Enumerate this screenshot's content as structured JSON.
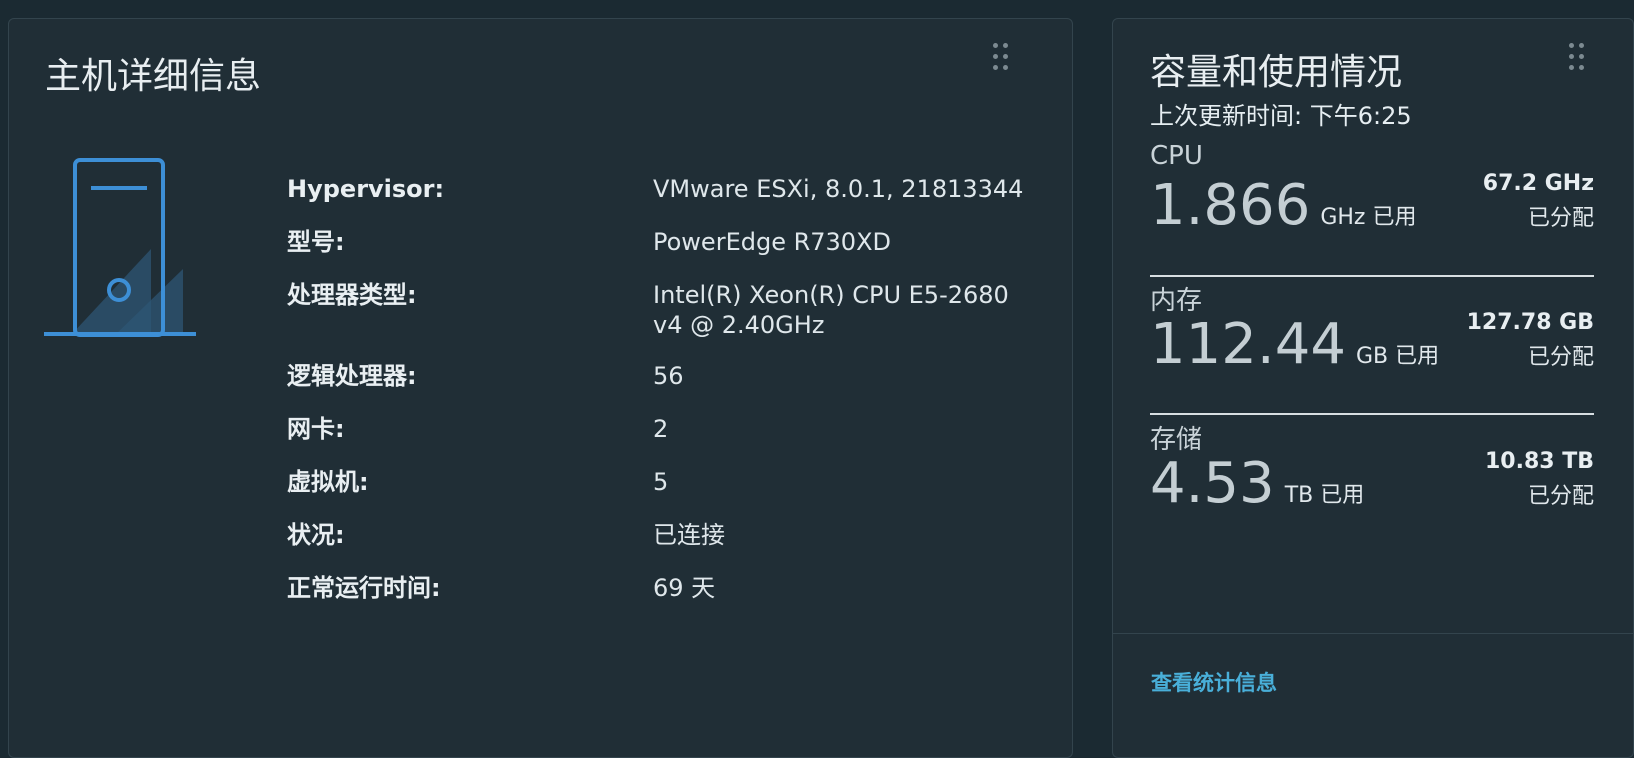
{
  "host_details": {
    "title": "主机详细信息",
    "icon": "server-icon",
    "rows": [
      {
        "label": "Hypervisor:",
        "value": "VMware ESXi, 8.0.1, 21813344"
      },
      {
        "label": "型号:",
        "value": "PowerEdge R730XD"
      },
      {
        "label": "处理器类型:",
        "value": "Intel(R) Xeon(R) CPU E5-2680 v4 @ 2.40GHz"
      },
      {
        "label": "逻辑处理器:",
        "value": "56"
      },
      {
        "label": "网卡:",
        "value": "2"
      },
      {
        "label": "虚拟机:",
        "value": "5"
      },
      {
        "label": "状况:",
        "value": "已连接"
      },
      {
        "label": "正常运行时间:",
        "value": "69 天"
      }
    ]
  },
  "capacity": {
    "title": "容量和使用情况",
    "last_updated": "上次更新时间: 下午6:25",
    "resources": [
      {
        "name": "CPU",
        "used": "1.866",
        "used_unit": "GHz 已用",
        "allocated": "67.2 GHz",
        "allocated_label": "已分配"
      },
      {
        "name": "内存",
        "used": "112.44",
        "used_unit": "GB 已用",
        "allocated": "127.78 GB",
        "allocated_label": "已分配"
      },
      {
        "name": "存储",
        "used": "4.53",
        "used_unit": "TB 已用",
        "allocated": "10.83 TB",
        "allocated_label": "已分配"
      }
    ],
    "stats_link": "查看统计信息"
  },
  "colors": {
    "background": "#1b2a32",
    "card": "#202e36",
    "accent_icon": "#3d8fd6",
    "link": "#49afd9"
  }
}
